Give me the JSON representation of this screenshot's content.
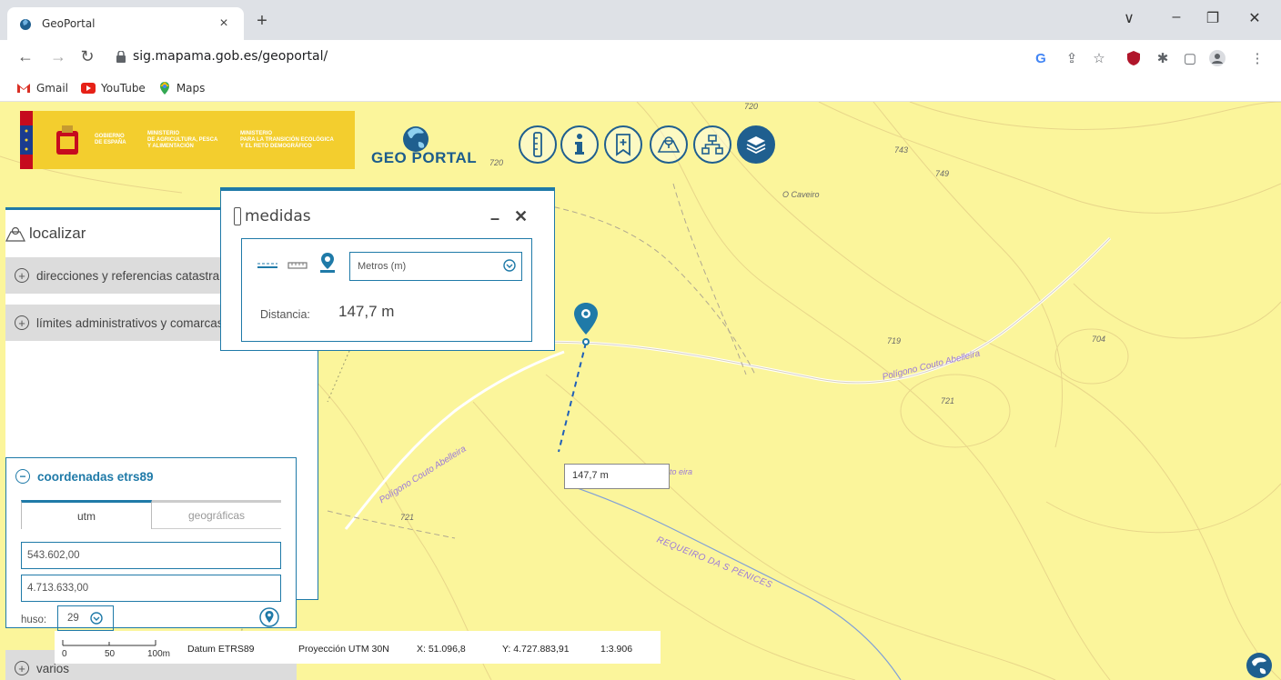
{
  "browser": {
    "tab_title": "GeoPortal",
    "tab_close": "×",
    "new_tab": "+",
    "url": "sig.mapama.gob.es/geoportal/",
    "window_controls": [
      "∨",
      "–",
      "❐",
      "✕"
    ],
    "bookmarks": [
      "Gmail",
      "YouTube",
      "Maps"
    ]
  },
  "header": {
    "gov_text": "GOBIERNO\nDE ESPAÑA",
    "min1_text": "MINISTERIO\nDE AGRICULTURA, PESCA\nY ALIMENTACIÓN",
    "min2_text": "MINISTERIO\nPARA LA TRANSICIÓN ECOLÓGICA\nY EL RETO DEMOGRÁFICO",
    "app_title": "GEO PORTAL",
    "tools": [
      "ruler-icon",
      "info-icon",
      "bookmark-icon",
      "map-search-icon",
      "sitemap-icon",
      "layers-icon"
    ]
  },
  "localizar": {
    "title": "localizar",
    "sections": [
      "direcciones y referencias catastrales",
      "límites administrativos y comarcas"
    ],
    "coordinates": {
      "title": "coordenadas etrs89",
      "tab_utm": "utm",
      "tab_geo": "geográficas",
      "x_value": "543.602,00",
      "y_value": "4.713.633,00",
      "huso_label": "huso:",
      "huso_value": "29"
    },
    "varios": "varios"
  },
  "medidas": {
    "title": "medidas",
    "min": "–",
    "close": "✕",
    "unit": "Metros (m)",
    "distance_label": "Distancia:",
    "distance_value": "147,7 m"
  },
  "map": {
    "tooltip": "147,7 m",
    "labels": [
      "O Caveiro",
      "743",
      "749",
      "720",
      "719",
      "704",
      "721",
      "721",
      "720"
    ],
    "road_labels": [
      "Polígono Couto Abelleira",
      "Polígono Couto Abelleira",
      "REQUEIRO DA S PENICES"
    ],
    "hidden_label": "to\neira"
  },
  "statusbar": {
    "scale_ticks": [
      "0",
      "50",
      "100m"
    ],
    "datum": "Datum ETRS89",
    "projection": "Proyección UTM 30N",
    "x": "X: 51.096,8",
    "y": "Y: 4.727.883,91",
    "scale": "1:3.906"
  },
  "colors": {
    "map_bg": "#fbf59b",
    "accent": "#1f7aa8",
    "brand_dark": "#1f5f8f",
    "logo_yellow": "#f3ce2e"
  }
}
